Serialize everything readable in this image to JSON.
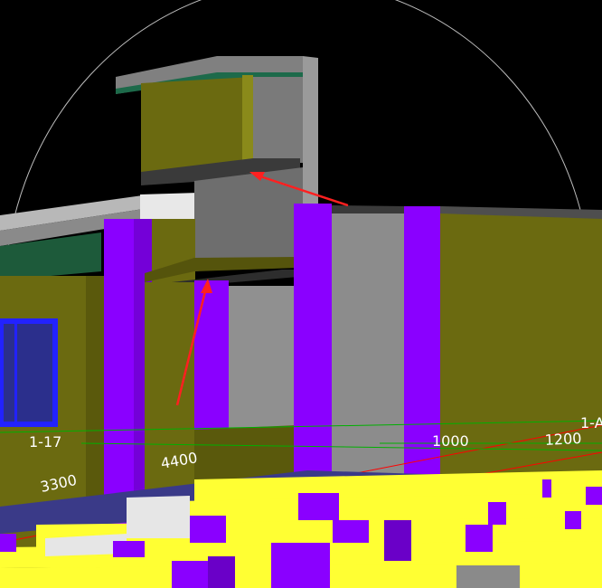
{
  "viewport": {
    "background_color": "#000000",
    "navigation_circle_color": "#bdbdbd"
  },
  "dimensions": {
    "label_3300": "3300",
    "label_4400": "4400",
    "label_1000": "1000",
    "label_1200": "1200",
    "axis_1_17": "1-17",
    "axis_1_a": "1-A"
  },
  "colors": {
    "column_purple": "#8a00ff",
    "wall_olive": "#6b6a10",
    "beam_yellow": "#ffff33",
    "concrete_gray": "#8a8a8a",
    "window_blue": "#2222ff",
    "annotation_arrow": "#ff2020",
    "grid_line_red": "#ff0000",
    "grid_line_green": "#00b000"
  },
  "annotations": {
    "arrow_1": "upper-ledge-pointer-arrow",
    "arrow_2": "lower-ledge-pointer-arrow"
  }
}
